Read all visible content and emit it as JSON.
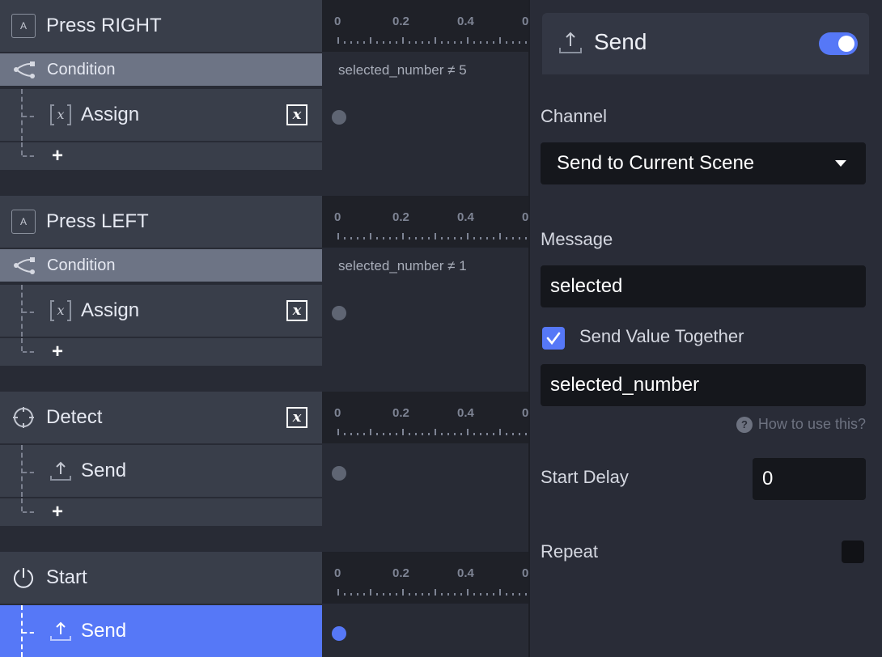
{
  "tree": {
    "groups": [
      {
        "header": {
          "label": "Press RIGHT",
          "icon": "key-icon",
          "key_glyph": "A"
        },
        "condition": {
          "label": "Condition",
          "icon": "branch-icon",
          "expression": "selected_number ≠ 5"
        },
        "actions": [
          {
            "label": "Assign",
            "icon": "variable-icon",
            "has_var_badge": true,
            "selected": false
          }
        ],
        "add_label": "+"
      },
      {
        "header": {
          "label": "Press LEFT",
          "icon": "key-icon",
          "key_glyph": "A"
        },
        "condition": {
          "label": "Condition",
          "icon": "branch-icon",
          "expression": "selected_number ≠ 1"
        },
        "actions": [
          {
            "label": "Assign",
            "icon": "variable-icon",
            "has_var_badge": true,
            "selected": false
          }
        ],
        "add_label": "+"
      },
      {
        "header": {
          "label": "Detect",
          "icon": "crosshair-icon",
          "has_var_badge": true
        },
        "actions": [
          {
            "label": "Send",
            "icon": "upload-icon",
            "selected": false
          }
        ],
        "add_label": "+"
      },
      {
        "header": {
          "label": "Start",
          "icon": "power-icon"
        },
        "actions": [
          {
            "label": "Send",
            "icon": "upload-icon",
            "selected": true
          }
        ]
      }
    ],
    "var_badge_glyph": "x"
  },
  "timeline": {
    "ruler_labels": [
      "0",
      "0.2",
      "0.4",
      "0"
    ]
  },
  "panel": {
    "title": "Send",
    "title_icon": "upload-icon",
    "enabled": true,
    "channel": {
      "label": "Channel",
      "value": "Send to Current Scene"
    },
    "message": {
      "label": "Message",
      "value": "selected"
    },
    "send_value": {
      "label": "Send Value Together",
      "checked": true,
      "value": "selected_number"
    },
    "help": {
      "icon": "?",
      "label": "How to use this?"
    },
    "start_delay": {
      "label": "Start Delay",
      "value": "0"
    },
    "repeat": {
      "label": "Repeat",
      "checked": false
    }
  },
  "colors": {
    "accent": "#5678f7",
    "row_bg": "#393e4a",
    "condition_bg": "#6d7485",
    "ruler_bg": "#1f2128",
    "input_bg": "#15171c"
  }
}
